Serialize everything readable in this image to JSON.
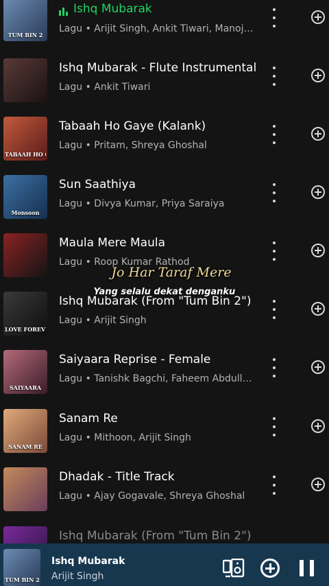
{
  "songs": [
    {
      "title": "Ishq Mubarak",
      "subtitle": "Lagu • Arijit Singh, Ankit Tiwari, Manoj M...",
      "playing": true,
      "art_text": "TUM BIN 2",
      "art_colors": [
        "#6c8cb3",
        "#2a3b58"
      ]
    },
    {
      "title": "Ishq Mubarak - Flute Instrumental",
      "subtitle": "Lagu • Ankit Tiwari",
      "playing": false,
      "art_text": "",
      "art_colors": [
        "#5a3a38",
        "#1a1212"
      ]
    },
    {
      "title": "Tabaah Ho Gaye (Kalank)",
      "subtitle": "Lagu • Pritam, Shreya Ghoshal",
      "playing": false,
      "art_text": "TABAAH HO GAYE",
      "art_colors": [
        "#c25a3d",
        "#5a1c1a"
      ]
    },
    {
      "title": "Sun Saathiya",
      "subtitle": "Lagu • Divya Kumar, Priya Saraiya",
      "playing": false,
      "art_text": "Monsoon",
      "art_colors": [
        "#3d6fa3",
        "#15304f"
      ]
    },
    {
      "title": "Maula Mere Maula",
      "subtitle": "Lagu • Roop Kumar Rathod",
      "playing": false,
      "art_text": "",
      "art_colors": [
        "#8a2222",
        "#141414"
      ]
    },
    {
      "title": "Ishq Mubarak (From \"Tum Bin 2\")",
      "subtitle": "Lagu • Arijit Singh",
      "playing": false,
      "art_text": "LOVE FOREVER",
      "art_colors": [
        "#3a3a3a",
        "#0e0e0e"
      ]
    },
    {
      "title": "Saiyaara Reprise - Female",
      "subtitle": "Lagu • Tanishk Bagchi, Faheem Abdullah,...",
      "playing": false,
      "art_text": "SAIYAARA",
      "art_colors": [
        "#b46a7a",
        "#3b1d2a"
      ]
    },
    {
      "title": "Sanam Re",
      "subtitle": "Lagu • Mithoon, Arijit Singh",
      "playing": false,
      "art_text": "SANAM RE",
      "art_colors": [
        "#e1a97a",
        "#7a4a3a"
      ]
    },
    {
      "title": "Dhadak - Title Track",
      "subtitle": "Lagu • Ajay Gogavale, Shreya Ghoshal",
      "playing": false,
      "art_text": "",
      "art_colors": [
        "#c48a5a",
        "#6a3e5a"
      ]
    },
    {
      "title": "Ishq Mubarak (From \"Tum Bin 2\")",
      "subtitle": "",
      "playing": false,
      "art_text": "",
      "art_colors": [
        "#7a2a9a",
        "#2a1440"
      ]
    }
  ],
  "lyrics": {
    "main": "Jo Har Taraf Mere",
    "translation": "Yang selalu dekat denganku"
  },
  "player": {
    "title": "Ishq Mubarak",
    "artist": "Arijit Singh",
    "bg_color": "#17374f"
  },
  "icons": {
    "more": "more-vertical-icon",
    "add": "add-circle-icon",
    "device": "connect-device-icon",
    "pause": "pause-icon",
    "equalizer": "equalizer-icon"
  }
}
